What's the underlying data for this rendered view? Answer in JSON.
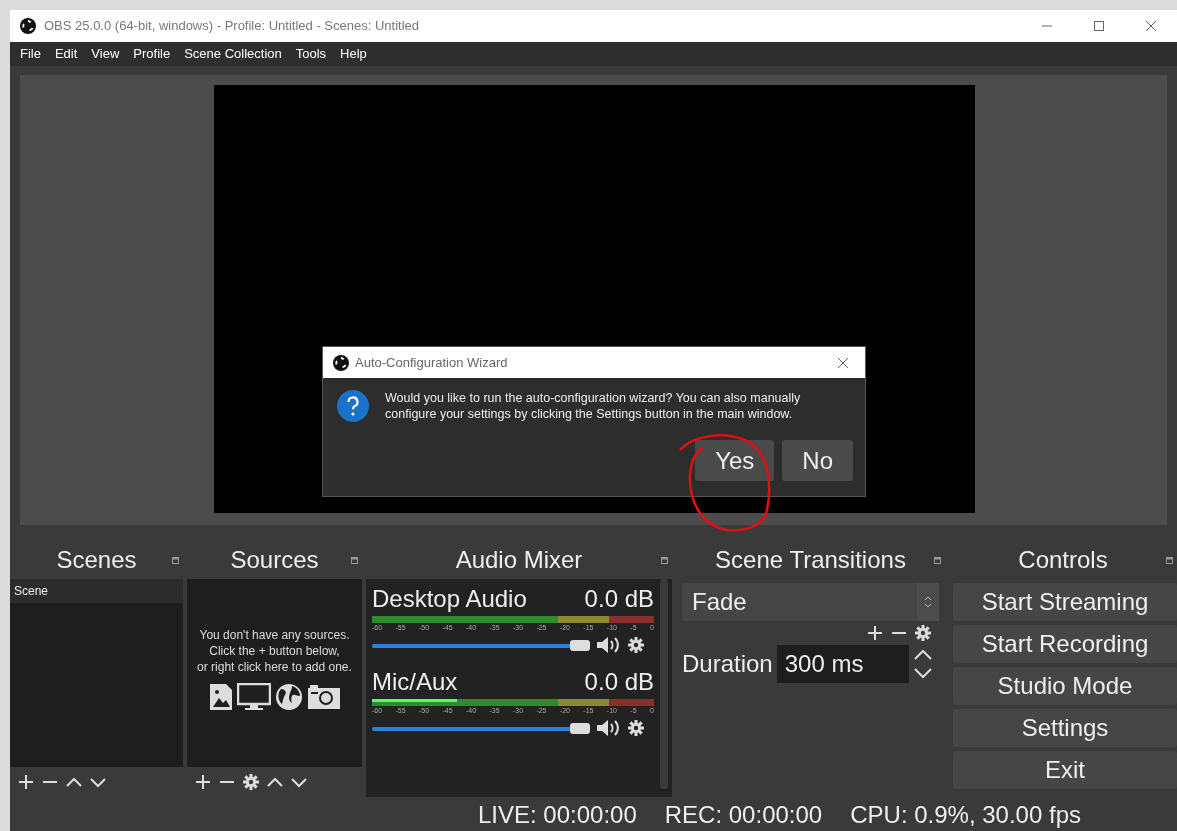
{
  "window": {
    "title": "OBS 25.0.0 (64-bit, windows) - Profile: Untitled - Scenes: Untitled"
  },
  "menu": [
    "File",
    "Edit",
    "View",
    "Profile",
    "Scene Collection",
    "Tools",
    "Help"
  ],
  "dialog": {
    "title": "Auto-Configuration Wizard",
    "message": "Would you like to run the auto-configuration wizard? You can also manually configure your settings by clicking the Settings button in the main window.",
    "buttons": [
      "Yes",
      "No"
    ]
  },
  "scenes": {
    "title": "Scenes",
    "items": [
      {
        "label": "Scene",
        "selected": true
      }
    ]
  },
  "sources": {
    "title": "Sources",
    "empty_message": [
      "You don't have any sources.",
      "Click the + button below,",
      "or right click here to add one."
    ]
  },
  "audio_mixer": {
    "title": "Audio Mixer",
    "channels": [
      {
        "name": "Desktop Audio",
        "reading": "0.0 dB",
        "volume": {
          "level": 1
        },
        "ticks": [
          "-60",
          "-55",
          "-50",
          "-45",
          "-40",
          "-35",
          "-30",
          "-25",
          "-20",
          "-15",
          "-10",
          "-5",
          "0"
        ]
      },
      {
        "name": "Mic/Aux",
        "reading": "0.0 dB",
        "meter": {
          "level": 0.3
        },
        "volume": {
          "level": 1
        },
        "ticks": [
          "-60",
          "-55",
          "-50",
          "-45",
          "-40",
          "-35",
          "-30",
          "-25",
          "-20",
          "-15",
          "-10",
          "-5",
          "0"
        ]
      }
    ]
  },
  "scene_transitions": {
    "title": "Scene Transitions",
    "transition": "Fade",
    "duration_label": "Duration",
    "duration": "300 ms"
  },
  "controls": {
    "title": "Controls",
    "buttons": [
      "Start Streaming",
      "Start Recording",
      "Studio Mode",
      "Settings",
      "Exit"
    ]
  },
  "status_bar": [
    "LIVE: 00:00:00",
    "REC: 00:00:00",
    "CPU: 0.9%, 30.00 fps"
  ]
}
